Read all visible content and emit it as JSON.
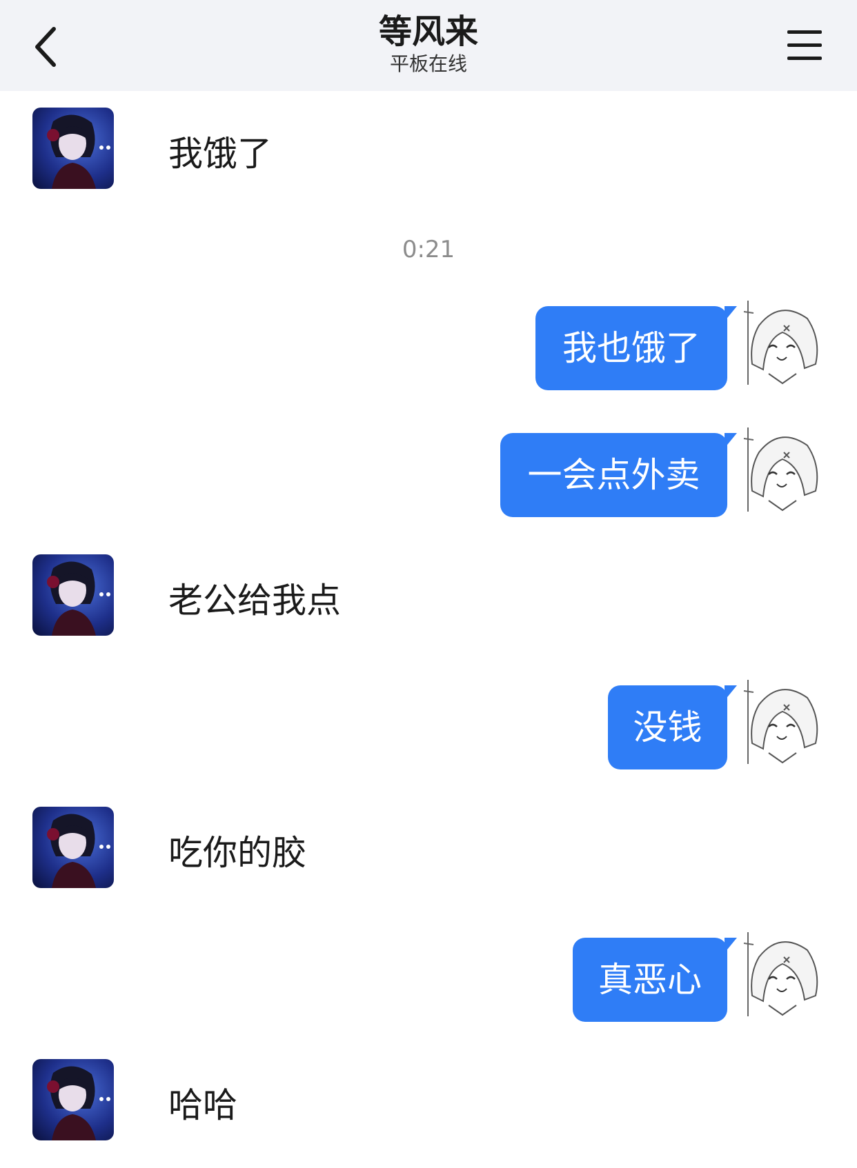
{
  "header": {
    "title": "等风来",
    "subtitle": "平板在线",
    "back_icon": "chevron-left-icon",
    "menu_icon": "hamburger-menu-icon",
    "background": "#f2f3f7"
  },
  "timestamp": "0:21",
  "colors": {
    "bubble": "#2f7df6",
    "bubble_text": "#ffffff",
    "text": "#1a1a1a",
    "timestamp": "#8c8c8c"
  },
  "messages": [
    {
      "side": "left",
      "text": "我饿了"
    },
    {
      "side": "right",
      "text": "我也饿了"
    },
    {
      "side": "right",
      "text": "一会点外卖"
    },
    {
      "side": "left",
      "text": "老公给我点"
    },
    {
      "side": "right",
      "text": "没钱"
    },
    {
      "side": "left",
      "text": "吃你的胶"
    },
    {
      "side": "right",
      "text": "真恶心"
    },
    {
      "side": "left",
      "text": "哈哈"
    }
  ]
}
